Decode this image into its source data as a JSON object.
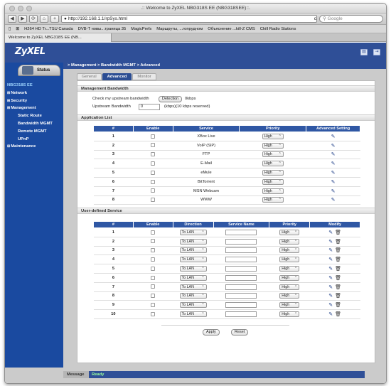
{
  "browser": {
    "window_title": ".:: Welcome to ZyXEL NBG318S EE (NBG318SEE)::.",
    "url": "http://192.168.1.1/rpSys.html",
    "search_placeholder": "Google",
    "bookmarks": [
      "H264 HD Tr...TSU Canada",
      "DVB-T новы...траница 35",
      "MagicPrefs",
      "Маршруты, ...гопрудном",
      "Объяснение ...kill-Z CMS",
      "Chill Radio Stations"
    ],
    "tab_title": "Welcome to ZyXEL NBG318S EE (NB..."
  },
  "router": {
    "logo": "ZyXEL",
    "status_label": "Status",
    "device_name": "NBG318S EE",
    "menu": [
      {
        "label": "Network",
        "type": "top"
      },
      {
        "label": "Security",
        "type": "top"
      },
      {
        "label": "Management",
        "type": "top"
      },
      {
        "label": "Static Route",
        "type": "sub"
      },
      {
        "label": "Bandwidth MGMT",
        "type": "sub"
      },
      {
        "label": "Remote MGMT",
        "type": "sub"
      },
      {
        "label": "UPnP",
        "type": "sub"
      },
      {
        "label": "Maintenance",
        "type": "top"
      }
    ],
    "breadcrumb": "> Management > Bandwidth MGMT > Advanced",
    "tabs": [
      "General",
      "Advanced",
      "Monitor"
    ],
    "active_tab": "Advanced",
    "mgmt_section": "Management Bandwidth",
    "check_label": "Check my upstream bandwidth",
    "detection_button": "Detection",
    "detected_value": "0kbps",
    "upstream_label": "Upstream Bandwidth",
    "upstream_value": "0",
    "upstream_unit": "(kbps)(10 kbps reserved)",
    "app_section": "Application List",
    "app_headers": [
      "#",
      "Enable",
      "Service",
      "Priority",
      "Advanced Setting"
    ],
    "app_rows": [
      {
        "num": "1",
        "service": "XBox Live",
        "priority": "High"
      },
      {
        "num": "2",
        "service": "VoIP (SIP)",
        "priority": "High"
      },
      {
        "num": "3",
        "service": "FTP",
        "priority": "High"
      },
      {
        "num": "4",
        "service": "E-Mail",
        "priority": "High"
      },
      {
        "num": "5",
        "service": "eMule",
        "priority": "High"
      },
      {
        "num": "6",
        "service": "BitTorrent",
        "priority": "High"
      },
      {
        "num": "7",
        "service": "MSN Webcam",
        "priority": "High"
      },
      {
        "num": "8",
        "service": "WWW",
        "priority": "High"
      }
    ],
    "user_section": "User-defined Service",
    "user_headers": [
      "#",
      "Enable",
      "Direction",
      "Service Name",
      "Priority",
      "Modify"
    ],
    "user_rows": [
      {
        "num": "1",
        "direction": "To LAN",
        "priority": "High"
      },
      {
        "num": "2",
        "direction": "To LAN",
        "priority": "High"
      },
      {
        "num": "3",
        "direction": "To LAN",
        "priority": "High"
      },
      {
        "num": "4",
        "direction": "To LAN",
        "priority": "High"
      },
      {
        "num": "5",
        "direction": "To LAN",
        "priority": "High"
      },
      {
        "num": "6",
        "direction": "To LAN",
        "priority": "High"
      },
      {
        "num": "7",
        "direction": "To LAN",
        "priority": "High"
      },
      {
        "num": "8",
        "direction": "To LAN",
        "priority": "High"
      },
      {
        "num": "9",
        "direction": "To LAN",
        "priority": "High"
      },
      {
        "num": "10",
        "direction": "To LAN",
        "priority": "High"
      }
    ],
    "apply_button": "Apply",
    "reset_button": "Reset",
    "message_label": "Message",
    "message_value": "Ready"
  }
}
